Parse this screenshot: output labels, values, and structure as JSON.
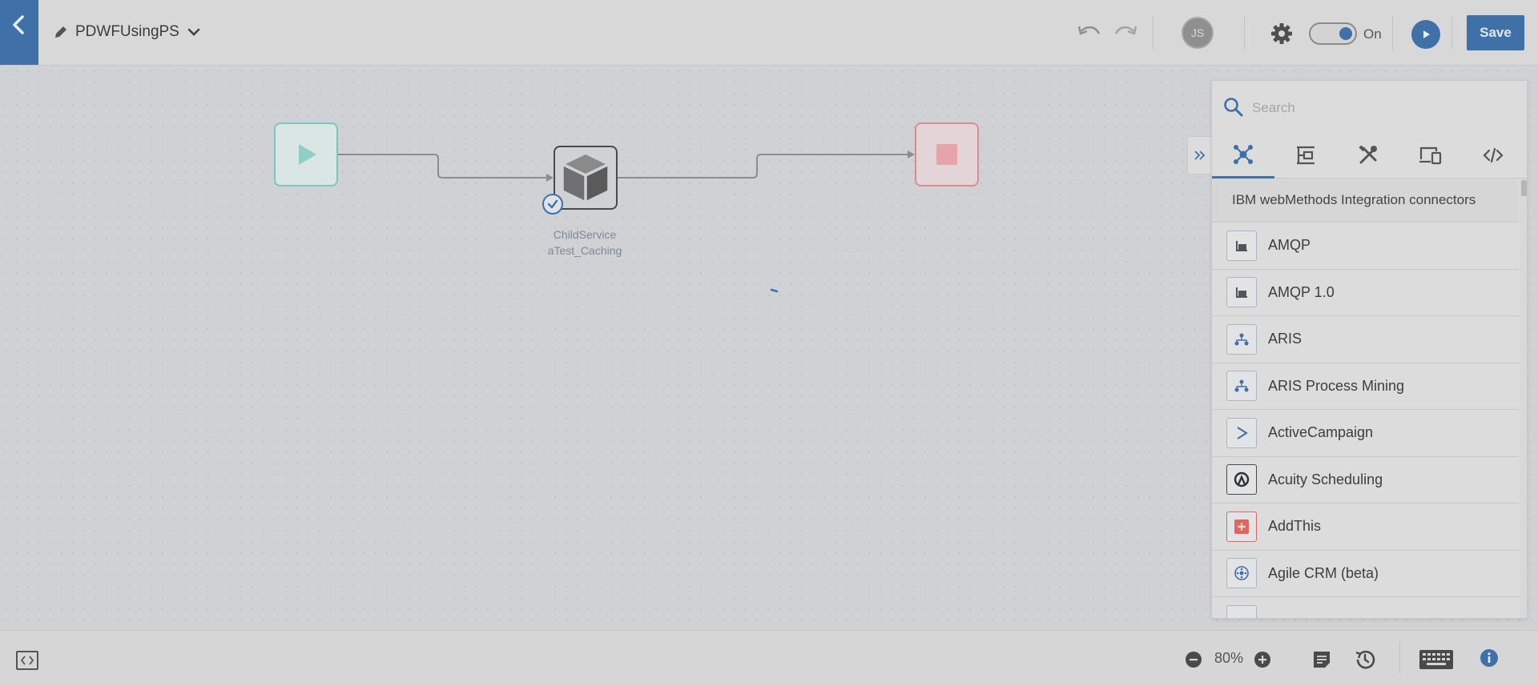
{
  "header": {
    "title": "PDWFUsingPS",
    "user_initials": "JS",
    "toggle_label": "On",
    "save_label": "Save"
  },
  "workflow": {
    "service_node_label_line1": "ChildService",
    "service_node_label_line2": "aTest_Caching"
  },
  "panel": {
    "search_placeholder": "Search",
    "section_title": "IBM webMethods Integration connectors",
    "items": [
      {
        "label": "AMQP",
        "icon": "amqp-icon"
      },
      {
        "label": "AMQP 1.0",
        "icon": "amqp-icon"
      },
      {
        "label": "ARIS",
        "icon": "aris-icon"
      },
      {
        "label": "ARIS Process Mining",
        "icon": "aris-icon"
      },
      {
        "label": "ActiveCampaign",
        "icon": "activecampaign-icon"
      },
      {
        "label": "Acuity Scheduling",
        "icon": "acuity-icon"
      },
      {
        "label": "AddThis",
        "icon": "addthis-icon"
      },
      {
        "label": "Agile CRM (beta)",
        "icon": "agilecrm-icon"
      }
    ]
  },
  "footer": {
    "zoom_level": "80%"
  },
  "colors": {
    "accent": "#3f70a8",
    "start_node": "#7cc7bd",
    "stop_node": "#dd8b92",
    "addthis": "#e4655f"
  }
}
